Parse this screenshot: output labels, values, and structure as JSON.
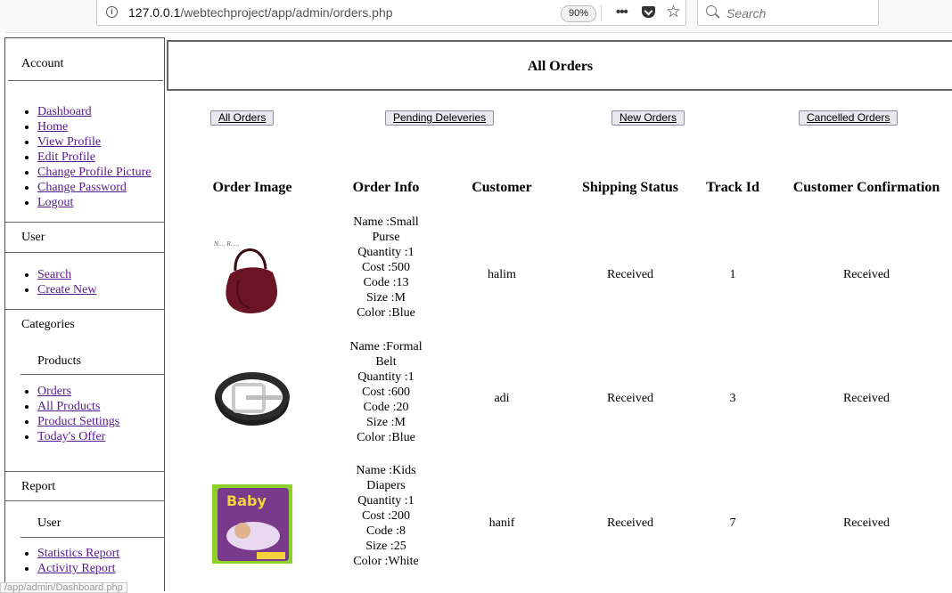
{
  "browser": {
    "url_prefix": "127.0.0.1",
    "url_path": "/webtechproject/app/admin/orders.php",
    "zoom": "90%",
    "search_placeholder": "Search",
    "status_link": "/app/admin/Dashboard.php"
  },
  "sidebar": {
    "account_heading": "Account",
    "account_links": [
      "Dashboard",
      "Home",
      "View Profile",
      "Edit Profile",
      "Change Profile Picture",
      "Change Password",
      "Logout"
    ],
    "user_heading": "User",
    "user_links": [
      "Search",
      "Create New"
    ],
    "categories_heading": "Categories",
    "products_subheading": "Products",
    "product_links": [
      "Orders",
      "All Products",
      "Product Settings",
      "Today's Offer"
    ],
    "report_heading": "Report",
    "report_user_subheading": "User",
    "report_links": [
      "Statistics Report",
      "Activity Report"
    ]
  },
  "main": {
    "title": "All Orders",
    "tabs": [
      "All Orders",
      "Pending Deleveries",
      "New Orders",
      "Cancelled Orders"
    ],
    "columns": [
      "Order Image",
      "Order Info",
      "Customer",
      "Shipping Status",
      "Track Id",
      "Customer Confirmation"
    ],
    "orders": [
      {
        "image": "handbag-image",
        "info": [
          "Name :Small",
          "Purse",
          "Quantity :1",
          "Cost :500",
          "Code :13",
          "Size :M",
          "Color :Blue"
        ],
        "customer": "halim",
        "shipping": "Received",
        "track": "1",
        "confirmation": "Received"
      },
      {
        "image": "belt-image",
        "info": [
          "Name :Formal",
          "Belt",
          "Quantity :1",
          "Cost :600",
          "Code :20",
          "Size :M",
          "Color :Blue"
        ],
        "customer": "adi",
        "shipping": "Received",
        "track": "3",
        "confirmation": "Received"
      },
      {
        "image": "diaper-pack-image",
        "info": [
          "Name :Kids",
          "Diapers",
          "Quantity :1",
          "Cost :200",
          "Code :8",
          "Size :25",
          "Color :White"
        ],
        "customer": "hanif",
        "shipping": "Received",
        "track": "7",
        "confirmation": "Received"
      }
    ]
  },
  "colors": {
    "link": "#551a8b",
    "bag": "#6b1424",
    "diaper_box": "#7a3a8c",
    "diaper_bg": "#8bd12a"
  }
}
